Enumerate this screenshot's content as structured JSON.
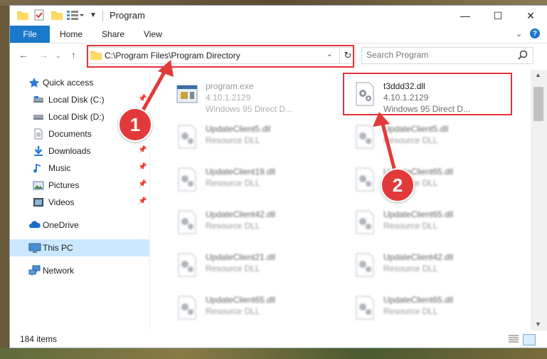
{
  "window": {
    "title": "Program"
  },
  "ribbon": {
    "tabs": [
      "File",
      "Home",
      "Share",
      "View"
    ]
  },
  "address": {
    "path": "C:\\Program Files\\Program Directory"
  },
  "search": {
    "placeholder": "Search Program"
  },
  "sidebar": {
    "items": [
      {
        "label": "Quick access",
        "icon": "star-icon",
        "pinned": false
      },
      {
        "label": "Local Disk (C:)",
        "icon": "drive-icon",
        "pinned": true
      },
      {
        "label": "Local Disk (D:)",
        "icon": "drive-icon",
        "pinned": true
      },
      {
        "label": "Documents",
        "icon": "document-icon",
        "pinned": true
      },
      {
        "label": "Downloads",
        "icon": "download-icon",
        "pinned": true
      },
      {
        "label": "Music",
        "icon": "music-icon",
        "pinned": true
      },
      {
        "label": "Pictures",
        "icon": "pictures-icon",
        "pinned": true
      },
      {
        "label": "Videos",
        "icon": "videos-icon",
        "pinned": true
      },
      {
        "label": "OneDrive",
        "icon": "cloud-icon",
        "pinned": false
      },
      {
        "label": "This PC",
        "icon": "computer-icon",
        "pinned": false,
        "selected": true
      },
      {
        "label": "Network",
        "icon": "network-icon",
        "pinned": false
      }
    ]
  },
  "files": [
    {
      "name": "program.exe",
      "line2": "4.10.1.2129",
      "line3": "Windows 95 Direct D...",
      "icon": "exe-icon"
    },
    {
      "name": "t3ddd32.dll",
      "line2": "4.10.1.2129",
      "line3": "Windows 95 Direct D...",
      "icon": "dll-gear-icon"
    },
    {
      "name": "UpdateClient5.dll",
      "line2": "Resource DLL"
    },
    {
      "name": "UpdateClient5.dll",
      "line2": "Resource DLL"
    },
    {
      "name": "UpdateClient19.dll",
      "line2": "Resource DLL"
    },
    {
      "name": "UpdateClient65.dll",
      "line2": "Resource DLL"
    },
    {
      "name": "UpdateClient42.dll",
      "line2": "Resource DLL"
    },
    {
      "name": "UpdateClient65.dll",
      "line2": "Resource DLL"
    },
    {
      "name": "UpdateClient21.dll",
      "line2": "Resource DLL"
    },
    {
      "name": "UpdateClient42.dll",
      "line2": "Resource DLL"
    },
    {
      "name": "UpdateClient65.dll",
      "line2": "Resource DLL"
    },
    {
      "name": "UpdateClient65.dll",
      "line2": "Resource DLL"
    }
  ],
  "status": {
    "item_count": "184 items"
  },
  "annotations": {
    "step1": "1",
    "step2": "2",
    "color": "#e23a3a"
  }
}
